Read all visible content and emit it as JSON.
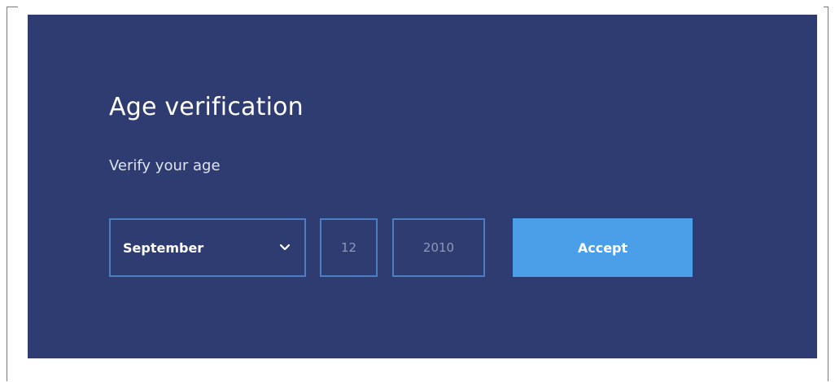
{
  "modal": {
    "title": "Age verification",
    "subtitle": "Verify your age",
    "month": {
      "value": "September",
      "icon": "chevron-down-icon"
    },
    "day": {
      "value": "12"
    },
    "year": {
      "value": "2010"
    },
    "accept_label": "Accept"
  },
  "colors": {
    "modal_background": "#2f3c71",
    "field_border": "#4b7fc1",
    "accept_button": "#4b9fe8",
    "title_text": "#ffffff",
    "placeholder_text": "#8e98b8"
  }
}
